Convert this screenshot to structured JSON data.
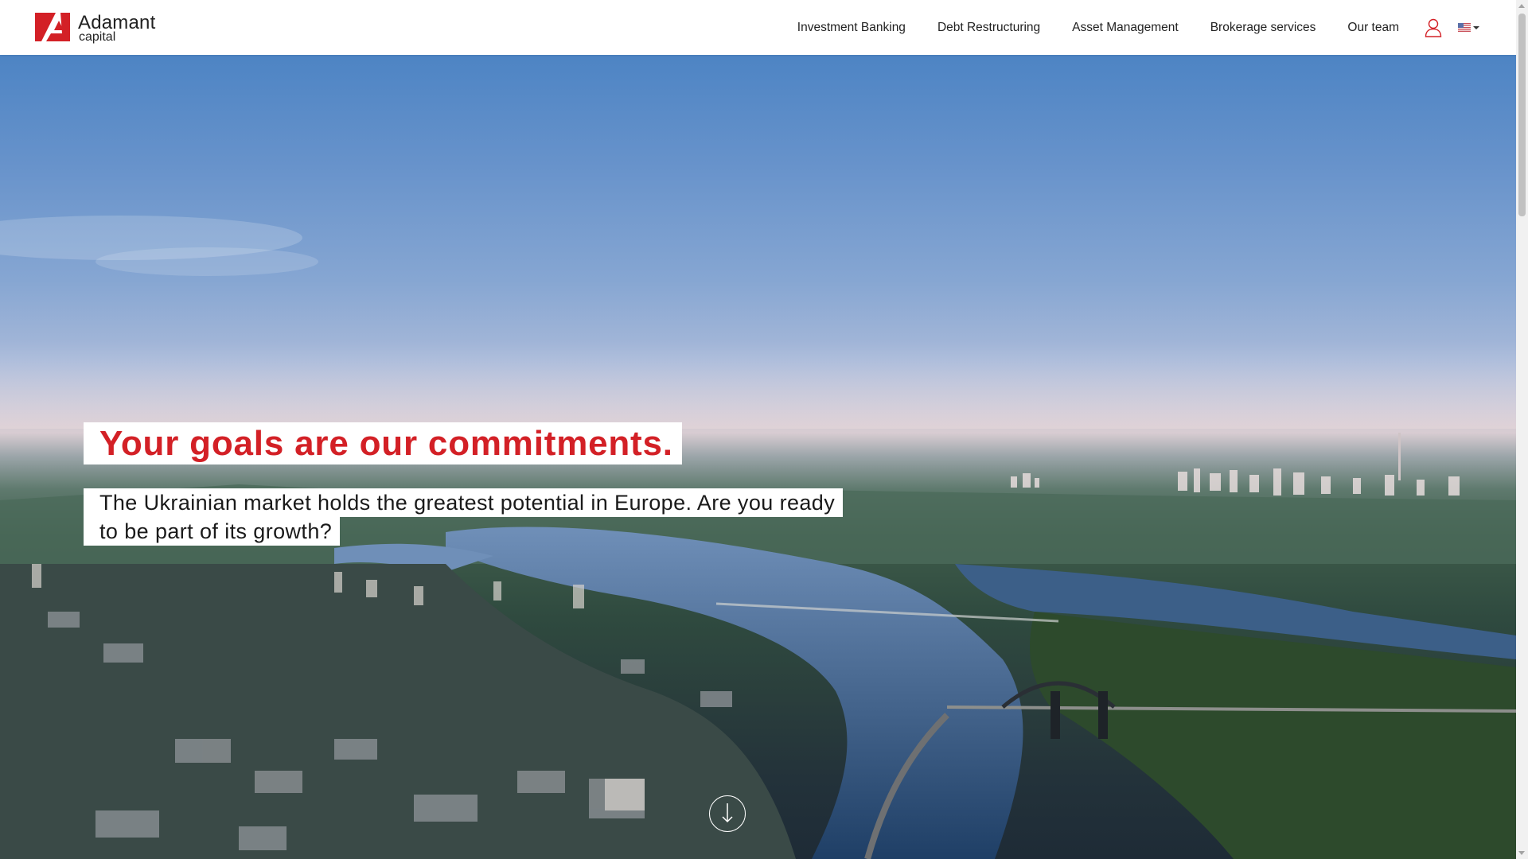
{
  "brand": {
    "name_main": "Adamant",
    "name_sub": "capital",
    "logo_icon": "adamant-logo-icon",
    "accent_color": "#d32026"
  },
  "nav": {
    "items": [
      {
        "label": "Investment Banking"
      },
      {
        "label": "Debt Restructuring"
      },
      {
        "label": "Asset Management"
      },
      {
        "label": "Brokerage services"
      },
      {
        "label": "Our team"
      }
    ],
    "user_icon": "user-icon",
    "language_icon": "us-flag-icon"
  },
  "hero": {
    "headline": "Your goals are our commitments.",
    "subline_line1": "The Ukrainian market holds the greatest potential in Europe. Are you ready",
    "subline_line2": "to be part of its growth?",
    "scroll_icon": "arrow-down-circle-icon",
    "headline_color": "#d32026"
  }
}
